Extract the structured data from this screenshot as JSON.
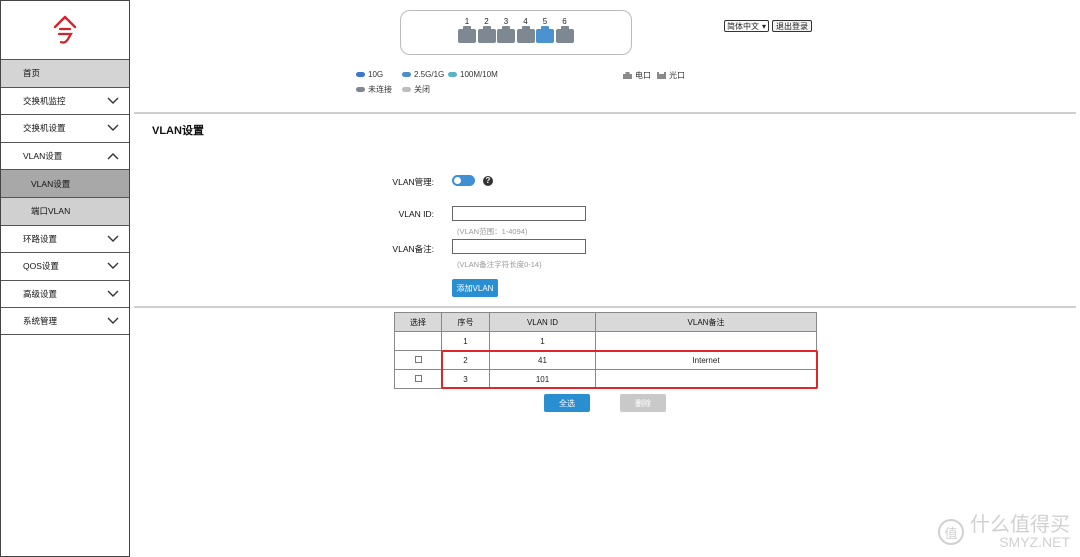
{
  "sidebar": {
    "logo_text": "今",
    "items": [
      {
        "label": "首页",
        "type": "home",
        "chevron": ""
      },
      {
        "label": "交换机监控",
        "type": "top",
        "chevron": "down"
      },
      {
        "label": "交换机设置",
        "type": "top",
        "chevron": "down"
      },
      {
        "label": "VLAN设置",
        "type": "top",
        "chevron": "up"
      },
      {
        "label": "VLAN设置",
        "type": "sub-active",
        "chevron": ""
      },
      {
        "label": "端口VLAN",
        "type": "sub",
        "chevron": ""
      },
      {
        "label": "环路设置",
        "type": "top",
        "chevron": "down"
      },
      {
        "label": "QOS设置",
        "type": "top",
        "chevron": "down"
      },
      {
        "label": "高级设置",
        "type": "top",
        "chevron": "down"
      },
      {
        "label": "系统管理",
        "type": "top",
        "chevron": "down"
      }
    ]
  },
  "ports": [
    {
      "label": "1",
      "active": false
    },
    {
      "label": "2",
      "active": false
    },
    {
      "label": "3",
      "active": false
    },
    {
      "label": "4",
      "active": false
    },
    {
      "label": "5",
      "active": true
    },
    {
      "label": "6",
      "active": false
    }
  ],
  "header": {
    "language": "简体中文",
    "logout": "退出登录"
  },
  "legend": {
    "g10": "10G",
    "g25": "2.5G/1G",
    "m100": "100M/10M",
    "disconnected": "未连接",
    "off": "关闭",
    "electric": "电口",
    "optical": "光口"
  },
  "colors": {
    "g10": "#3a76d2",
    "g25": "#4a8fc7",
    "m100": "#58b3c9",
    "disconnected": "#7d8893",
    "off": "#bdbdbd",
    "accent": "#2a8fd0",
    "highlight": "#e0262a"
  },
  "page": {
    "title": "VLAN设置",
    "vlan_manage_label": "VLAN管理:",
    "vlan_id_label": "VLAN ID:",
    "vlan_id_hint": "(VLAN范围：1-4094)",
    "vlan_note_label": "VLAN备注:",
    "vlan_note_hint": "(VLAN备注字符长度0-14)",
    "add_button": "添加VLAN",
    "select_all_button": "全选",
    "delete_button": "删除"
  },
  "table": {
    "headers": [
      "选择",
      "序号",
      "VLAN ID",
      "VLAN备注"
    ],
    "rows": [
      {
        "checkbox": false,
        "index": "1",
        "vlan_id": "1",
        "note": ""
      },
      {
        "checkbox": true,
        "index": "2",
        "vlan_id": "41",
        "note": "Internet"
      },
      {
        "checkbox": true,
        "index": "3",
        "vlan_id": "101",
        "note": ""
      }
    ]
  },
  "watermark": {
    "text": "什么值得买",
    "sub": "SMYZ.NET",
    "icon": "值"
  }
}
